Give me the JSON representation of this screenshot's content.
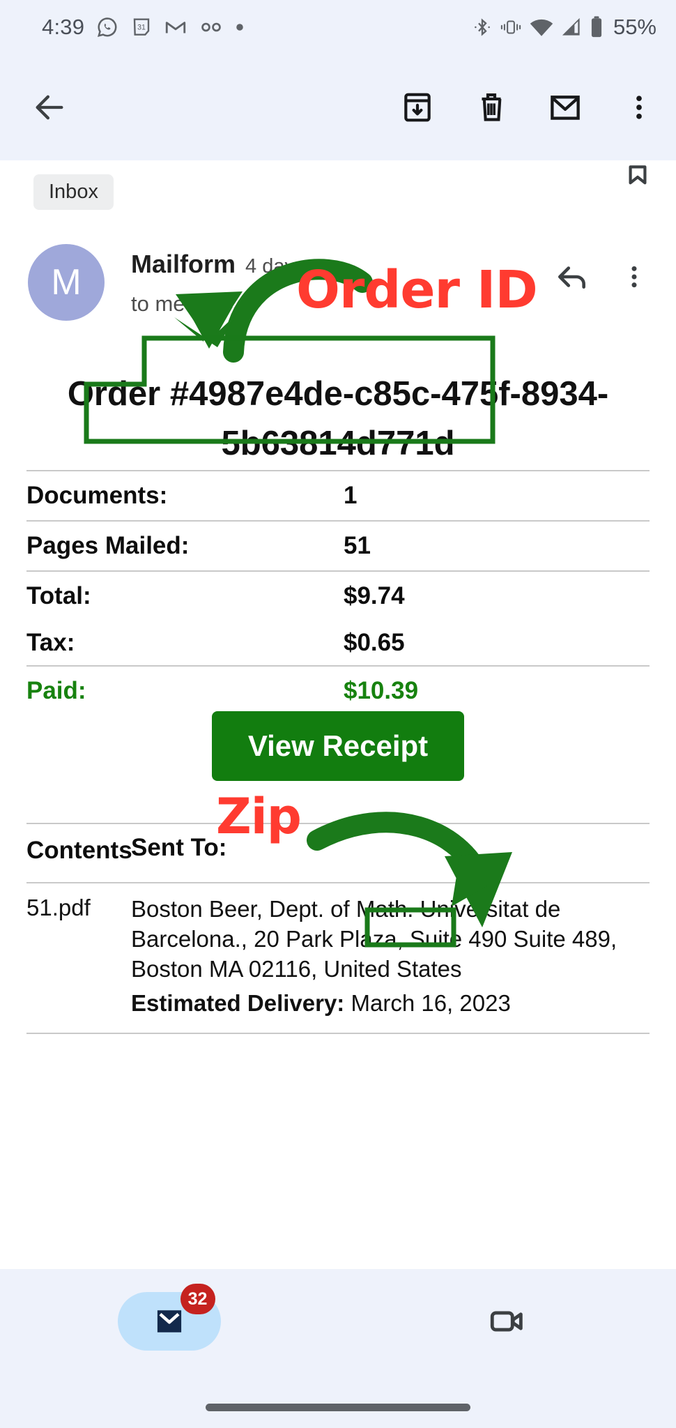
{
  "status_bar": {
    "time": "4:39",
    "battery_percent": "55%",
    "left_icons": [
      "whatsapp-icon",
      "calendar-31-icon",
      "gmail-icon",
      "voicemail-icon",
      "dot-icon"
    ],
    "right_icons": [
      "bluetooth-icon",
      "vibrate-icon",
      "wifi-icon",
      "signal-icon",
      "battery-icon"
    ]
  },
  "app_bar": {
    "back_icon": "back-arrow-icon",
    "actions": [
      "archive-icon",
      "delete-icon",
      "mark-unread-icon",
      "more-options-icon"
    ]
  },
  "email": {
    "label_chip": "Inbox",
    "bookmark_icon": "bookmark-outline-icon",
    "avatar_initial": "M",
    "avatar_color": "#9fa8da",
    "sender": "Mailform",
    "timestamp": "4 days ago",
    "recipient": "to me",
    "recipient_expand_icon": "chevron-down-icon",
    "reply_icon": "reply-icon",
    "more_icon": "more-options-icon",
    "order_title_prefix": "Order #",
    "order_id": "4987e4de-c85c-475f-8934-5b63814d771d",
    "summary": [
      {
        "label": "Documents:",
        "value": "1",
        "highlight": false
      },
      {
        "label": "Pages Mailed:",
        "value": "51",
        "highlight": false
      },
      {
        "label": "Total:",
        "value": "$9.74",
        "highlight": false
      },
      {
        "label": "Tax:",
        "value": "$0.65",
        "highlight": false
      },
      {
        "label": "Paid:",
        "value": "$10.39",
        "highlight": true
      }
    ],
    "receipt_button": "View Receipt",
    "contents_table": {
      "header_contents": "Contents",
      "header_sent_to": "Sent To:",
      "file_name": "51.pdf",
      "address": "Boston Beer, Dept. of Math. Universitat de Barcelona., 20 Park Plaza, Suite 490 Suite 489, Boston MA 02116, United States",
      "delivery_label": "Estimated Delivery:",
      "delivery_date": "March 16, 2023",
      "zip": "02116,"
    }
  },
  "annotations": {
    "order_id_label": "Order ID",
    "zip_label": "Zip",
    "label_color": "#ff3b30",
    "box_color": "#1a7a1a",
    "arrow_color": "#1b7a1b"
  },
  "bottom_nav": {
    "items": [
      {
        "icon": "mail-icon",
        "badge": "32",
        "active": true
      },
      {
        "icon": "video-call-icon",
        "badge": "",
        "active": false
      }
    ]
  },
  "colors": {
    "chrome_bg": "#eef2fb",
    "paid_green": "#17820f",
    "button_green": "#127d0f",
    "badge_red": "#c5221f"
  }
}
